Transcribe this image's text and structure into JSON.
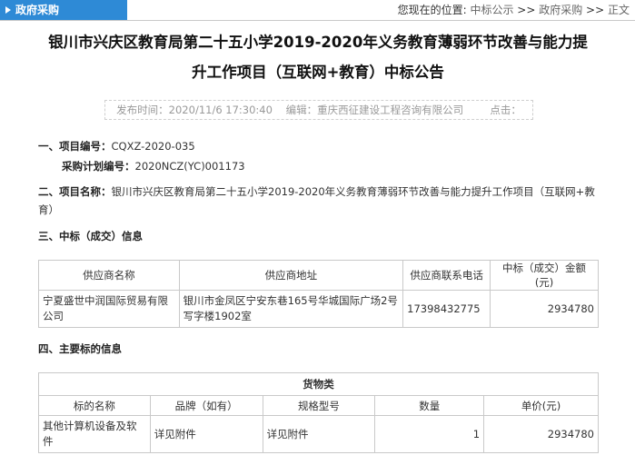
{
  "topbar": {
    "section_label": "政府采购",
    "location_label": "您现在的位置:",
    "breadcrumbs": [
      {
        "label": "中标公示"
      },
      {
        "label": "政府采购"
      },
      {
        "label": "正文"
      }
    ],
    "separator": " >> "
  },
  "article": {
    "title_line1": "银川市兴庆区教育局第二十五小学2019-2020年义务教育薄弱环节改善与能力提",
    "title_line2": "升工作项目（互联网+教育）中标公告",
    "meta": {
      "publish_label": "发布时间：",
      "publish_time": "2020/11/6 17:30:40",
      "editor_label": "编辑：",
      "editor": "重庆西征建设工程咨询有限公司",
      "clicks_label": "点击："
    },
    "section1": {
      "heading": "一、",
      "project_no_label": "项目编号：",
      "project_no": "CQXZ-2020-035",
      "plan_no_label": "采购计划编号：",
      "plan_no": "2020NCZ(YC)001173"
    },
    "section2": {
      "heading": "二、",
      "name_label": "项目名称：",
      "name": "银川市兴庆区教育局第二十五小学2019-2020年义务教育薄弱环节改善与能力提升工作项目（互联网+教育）"
    },
    "section3": {
      "heading": "三、中标（成交）信息",
      "table": {
        "headers": [
          "供应商名称",
          "供应商地址",
          "供应商联系电话",
          "中标（成交）金额(元)"
        ],
        "rows": [
          [
            "宁夏盛世中润国际贸易有限公司",
            "银川市金凤区宁安东巷165号华城国际广场2号写字楼1902室",
            "17398432775",
            "2934780"
          ]
        ]
      }
    },
    "section4": {
      "heading": "四、主要标的信息",
      "table": {
        "caption": "货物类",
        "headers": [
          "标的名称",
          "品牌（如有）",
          "规格型号",
          "数量",
          "单价(元)"
        ],
        "rows": [
          [
            "其他计算机设备及软件",
            "详见附件",
            "详见附件",
            "1",
            "2934780"
          ]
        ]
      }
    }
  }
}
